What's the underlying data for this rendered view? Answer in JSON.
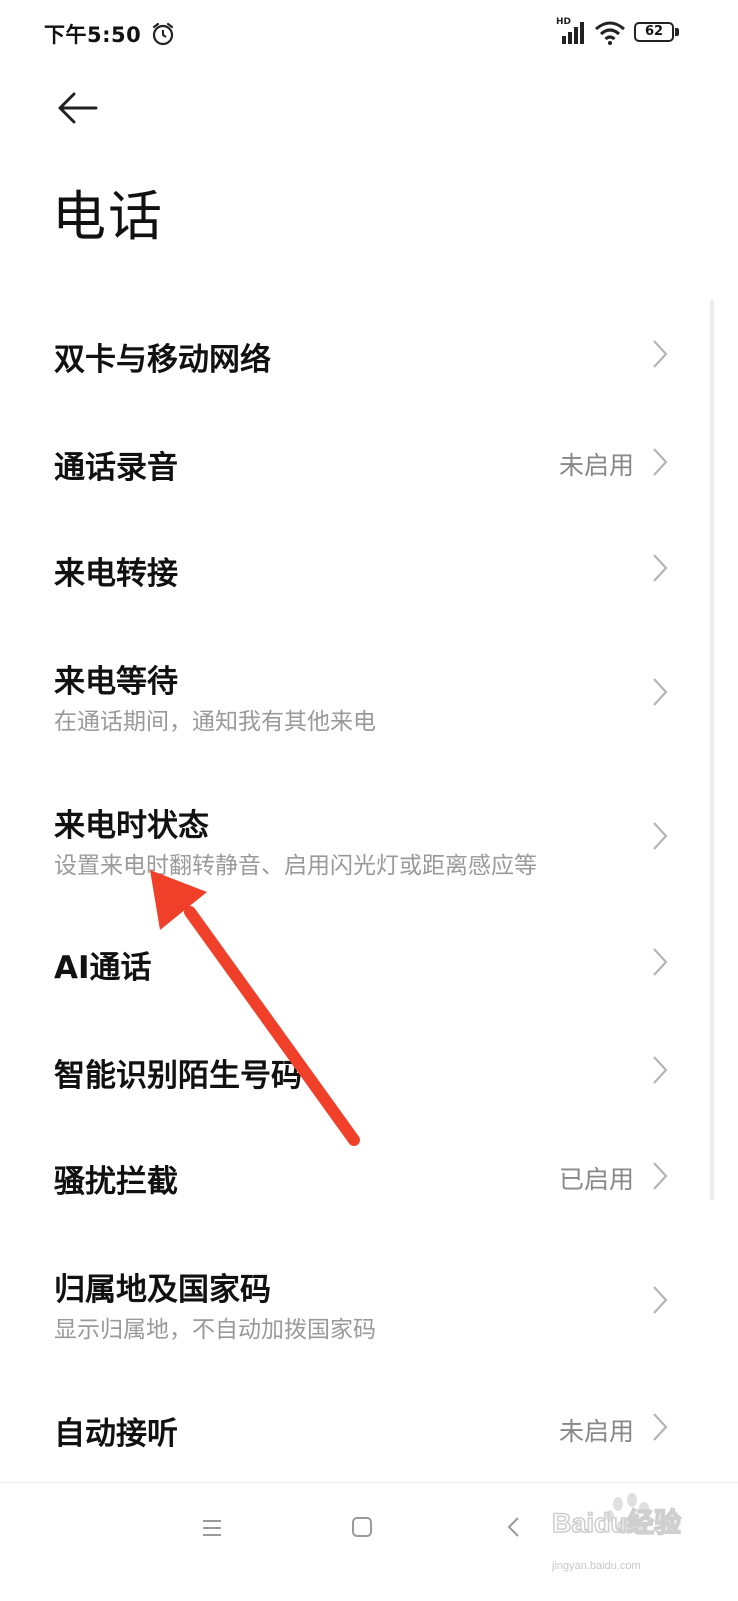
{
  "status_bar": {
    "time": "下午5:50",
    "network_label": "HD",
    "battery": "62"
  },
  "page": {
    "title": "电话"
  },
  "settings": [
    {
      "title": "双卡与移动网络",
      "subtitle": "",
      "value": ""
    },
    {
      "title": "通话录音",
      "subtitle": "",
      "value": "未启用"
    },
    {
      "title": "来电转接",
      "subtitle": "",
      "value": ""
    },
    {
      "title": "来电等待",
      "subtitle": "在通话期间，通知我有其他来电",
      "value": ""
    },
    {
      "title": "来电时状态",
      "subtitle": "设置来电时翻转静音、启用闪光灯或距离感应等",
      "value": ""
    },
    {
      "title": "AI通话",
      "subtitle": "",
      "value": ""
    },
    {
      "title": "智能识别陌生号码",
      "subtitle": "",
      "value": ""
    },
    {
      "title": "骚扰拦截",
      "subtitle": "",
      "value": "已启用"
    },
    {
      "title": "归属地及国家码",
      "subtitle": "显示归属地，不自动加拨国家码",
      "value": ""
    },
    {
      "title": "自动接听",
      "subtitle": "",
      "value": "未启用"
    }
  ],
  "annotation": {
    "arrow_color": "#f0402a"
  },
  "watermark": {
    "brand": "Baidu经验",
    "url": "jingyan.baidu.com"
  }
}
